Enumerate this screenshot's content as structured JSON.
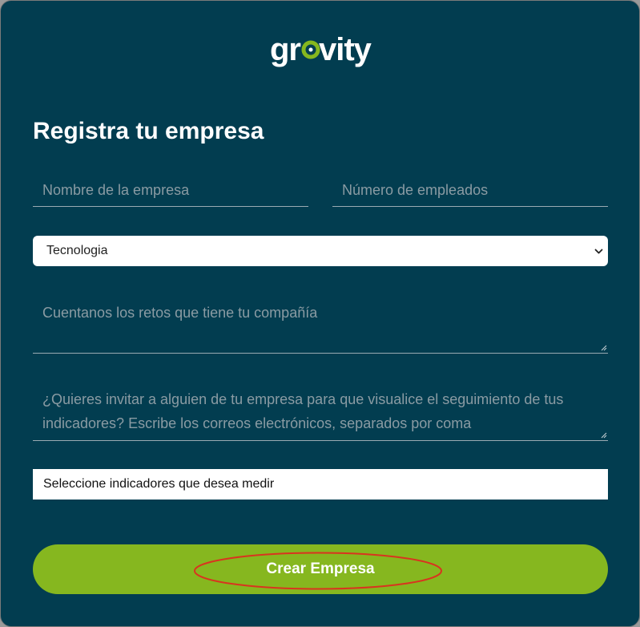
{
  "brand": {
    "logo_text": "grovity",
    "logo_accent_color": "#86b71f"
  },
  "form": {
    "title": "Registra tu empresa",
    "company_name_placeholder": "Nombre de la empresa",
    "employees_placeholder": "Número de empleados",
    "sector_select": {
      "selected": "Tecnologia",
      "icon": "chevron-down-icon"
    },
    "challenges_placeholder": "Cuentanos los retos que tiene tu compañía",
    "invite_placeholder": "¿Quieres invitar a alguien de tu empresa para que visualice el seguimiento de tus indicadores? Escribe los correos electrónicos, separados por coma",
    "indicators_placeholder": "Seleccione indicadores que desea medir",
    "submit_label": "Crear Empresa"
  },
  "colors": {
    "background": "#023d50",
    "button": "#86b71f",
    "annotation": "#d9341f"
  }
}
